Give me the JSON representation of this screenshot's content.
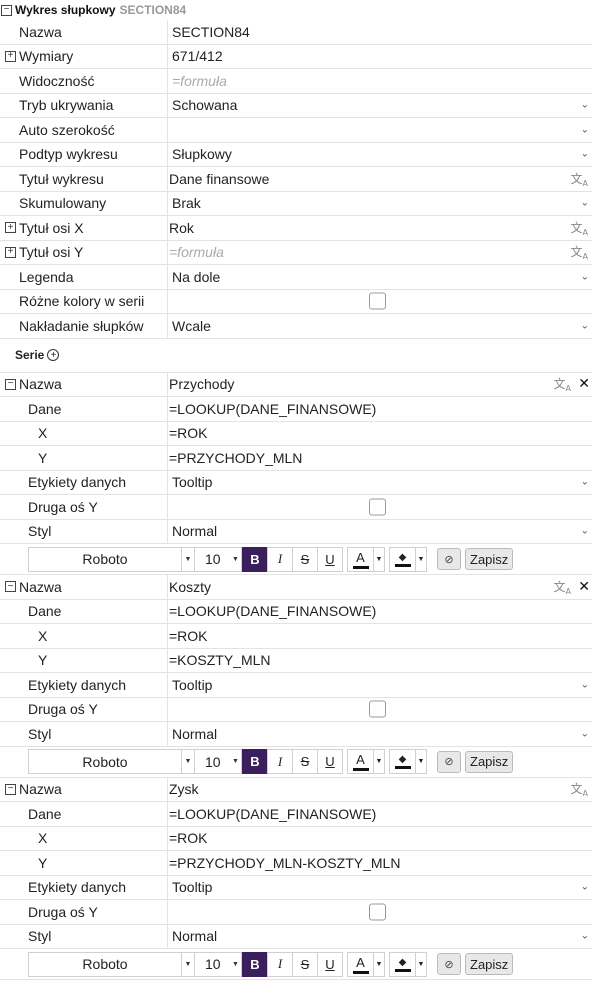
{
  "header": {
    "title": "Wykres słupkowy",
    "section": "SECTION84"
  },
  "props": [
    {
      "label": "Nazwa",
      "value": "SECTION84"
    },
    {
      "label": "Wymiary",
      "value": "671/412"
    },
    {
      "label": "Widoczność",
      "placeholder": "=formuła"
    },
    {
      "label": "Tryb ukrywania",
      "value": "Schowana"
    },
    {
      "label": "Auto szerokość",
      "value": ""
    },
    {
      "label": "Podtyp wykresu",
      "value": "Słupkowy"
    },
    {
      "label": "Tytuł wykresu",
      "value": "Dane finansowe"
    },
    {
      "label": "Skumulowany",
      "value": "Brak"
    },
    {
      "label": "Tytuł osi X",
      "value": "Rok"
    },
    {
      "label": "Tytuł osi Y",
      "placeholder": "=formuła"
    },
    {
      "label": "Legenda",
      "value": "Na dole"
    },
    {
      "label": "Różne kolory w serii",
      "value": ""
    },
    {
      "label": "Nakładanie słupków",
      "value": "Wcale"
    }
  ],
  "serie_label": "Serie",
  "series": [
    {
      "name_label": "Nazwa",
      "name": "Przychody",
      "dane_label": "Dane",
      "dane": "=LOOKUP(DANE_FINANSOWE)",
      "x_label": "X",
      "x": "=ROK",
      "y_label": "Y",
      "y": "=PRZYCHODY_MLN",
      "labels_label": "Etykiety danych",
      "labels": "Tooltip",
      "axis_label": "Druga oś Y",
      "style_label": "Styl",
      "style": "Normal"
    },
    {
      "name_label": "Nazwa",
      "name": "Koszty",
      "dane_label": "Dane",
      "dane": "=LOOKUP(DANE_FINANSOWE)",
      "x_label": "X",
      "x": "=ROK",
      "y_label": "Y",
      "y": "=KOSZTY_MLN",
      "labels_label": "Etykiety danych",
      "labels": "Tooltip",
      "axis_label": "Druga oś Y",
      "style_label": "Styl",
      "style": "Normal"
    },
    {
      "name_label": "Nazwa",
      "name": "Zysk",
      "dane_label": "Dane",
      "dane": "=LOOKUP(DANE_FINANSOWE)",
      "x_label": "X",
      "x": "=ROK",
      "y_label": "Y",
      "y": "=PRZYCHODY_MLN-KOSZTY_MLN",
      "labels_label": "Etykiety danych",
      "labels": "Tooltip",
      "axis_label": "Druga oś Y",
      "style_label": "Styl",
      "style": "Normal"
    }
  ],
  "toolbar": {
    "font": "Roboto",
    "size": "10",
    "bold": "B",
    "italic": "I",
    "strike": "S",
    "underline": "U",
    "font_color_glyph": "A",
    "fill_glyph": "◆",
    "save": "Zapisz",
    "font_color": "#111111",
    "bold_bg": "#3b1f5c"
  },
  "icons": {
    "collapse": "minus-box-icon",
    "expand": "plus-box-icon",
    "translate": "translate-icon",
    "close": "close-icon",
    "chevron": "chevron-down-icon",
    "add": "plus-circle-icon",
    "clear": "clear-format-icon"
  }
}
